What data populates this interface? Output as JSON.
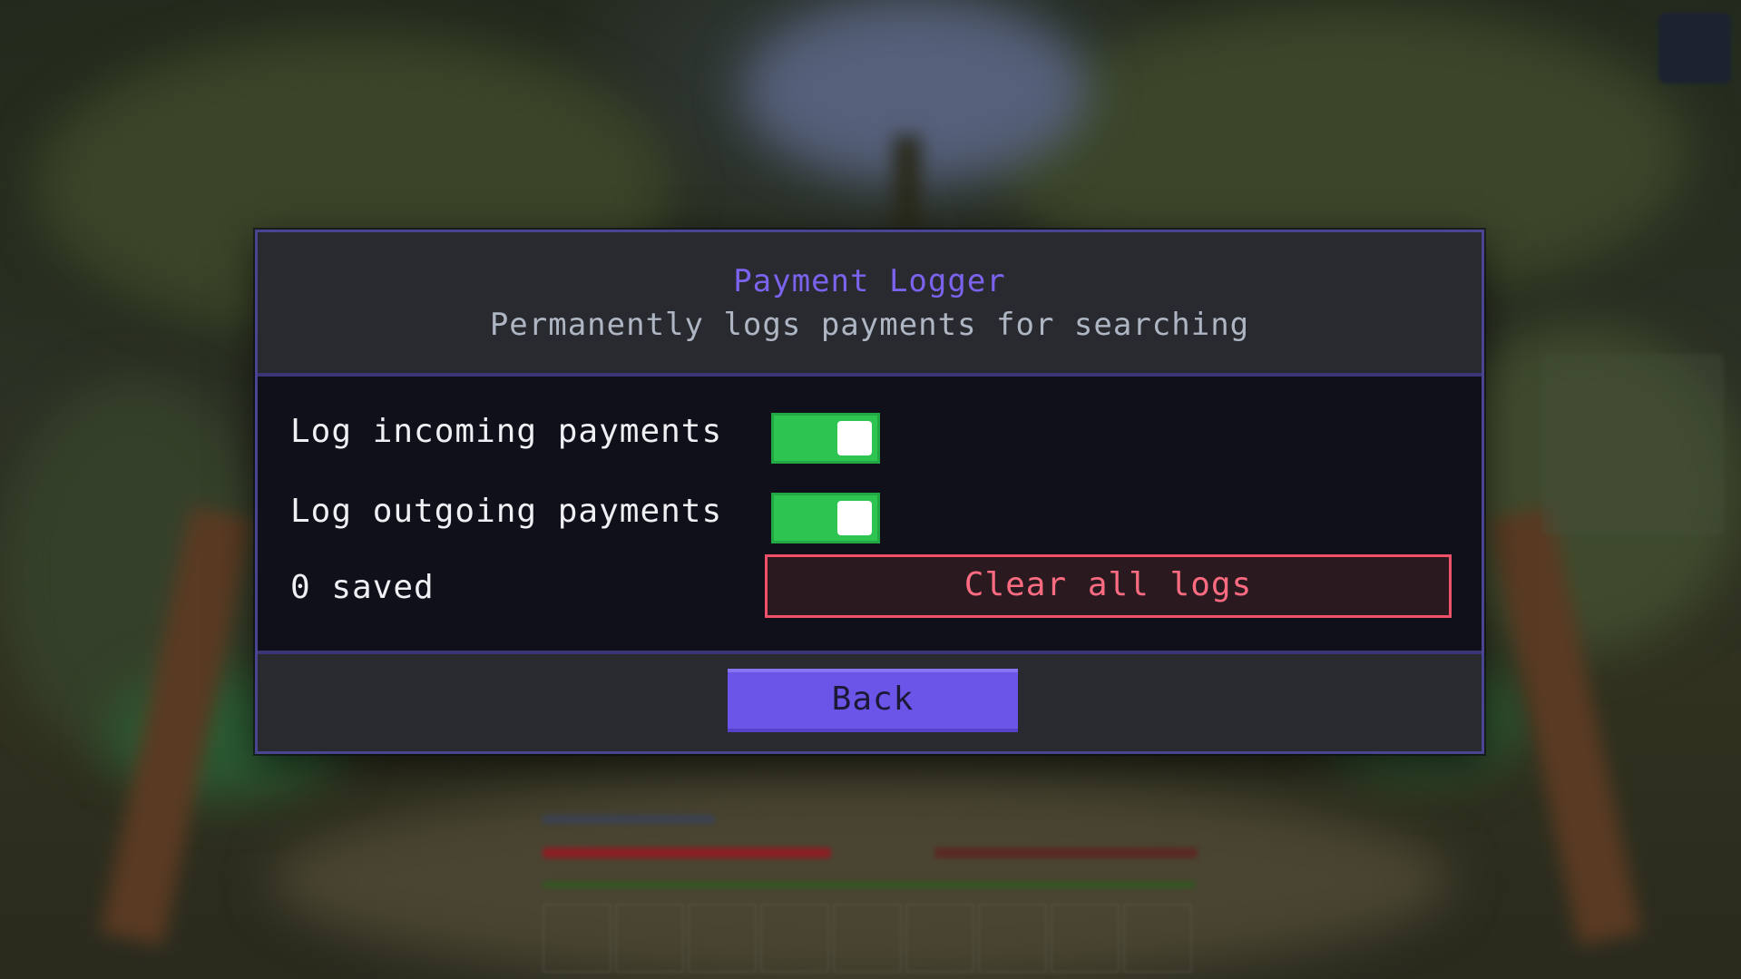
{
  "dialog": {
    "title": "Payment Logger",
    "subtitle": "Permanently logs payments for searching"
  },
  "settings": {
    "incoming": {
      "label": "Log incoming payments",
      "enabled": true
    },
    "outgoing": {
      "label": "Log outgoing payments",
      "enabled": true
    },
    "saved_count": "0 saved",
    "clear_label": "Clear all logs"
  },
  "footer": {
    "back_label": "Back"
  },
  "colors": {
    "accent": "#7c63ee",
    "toggle_on": "#2ec452",
    "danger": "#f0506a",
    "panel": "#282a30",
    "body": "#0f1019"
  }
}
